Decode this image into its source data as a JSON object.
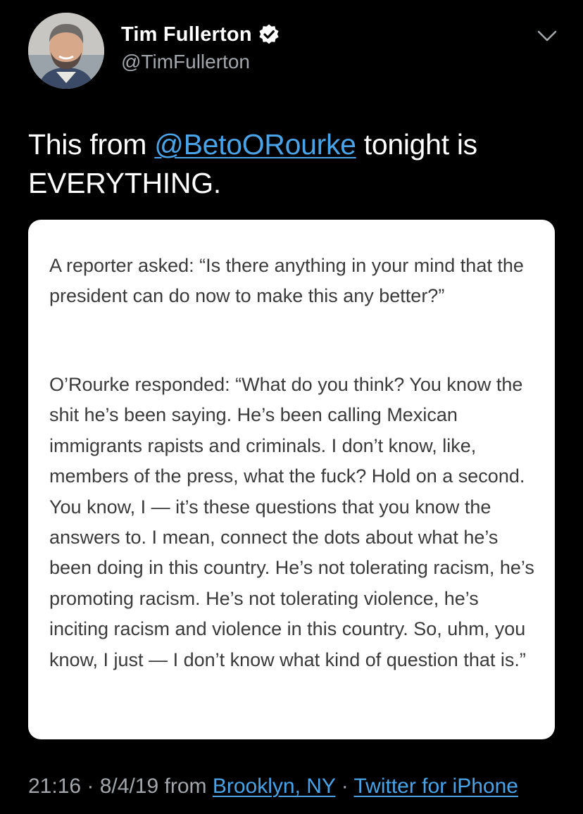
{
  "author": {
    "name": "Tim Fullerton",
    "handle": "@TimFullerton",
    "verified": true
  },
  "icons": {
    "verified": "verified-badge-icon",
    "more": "chevron-down-icon"
  },
  "tweet": {
    "text_prefix": "This from ",
    "mention": "@BetoORourke",
    "text_suffix": " tonight is EVERYTHING."
  },
  "media": {
    "paragraph_1": "A reporter asked: “Is there anything in your mind that the president can do now to make this any better?”",
    "paragraph_2": "O’Rourke responded: “What do you think? You know the shit he’s been saying. He’s been calling Mexican immigrants rapists and criminals. I don’t know, like, members of the press, what the fuck? Hold on a second. You know, I — it’s these questions that you know the answers to. I mean, connect the dots about what he’s been doing in this country. He’s not tolerating racism, he’s promoting racism. He’s not tolerating violence, he’s inciting racism and violence in this country. So, uhm, you know, I just — I don’t know what kind of question that is.”"
  },
  "meta": {
    "time": "21:16",
    "separator_1": " · ",
    "date": "8/4/19",
    "from_word": " from ",
    "location": "Brooklyn, NY",
    "separator_2": " · ",
    "source": "Twitter for iPhone"
  },
  "colors": {
    "background": "#000000",
    "text_primary": "#ffffff",
    "text_secondary": "#a3a7ab",
    "link": "#4aa3e6",
    "card_background": "#ffffff",
    "card_text": "#3a3a3a"
  }
}
